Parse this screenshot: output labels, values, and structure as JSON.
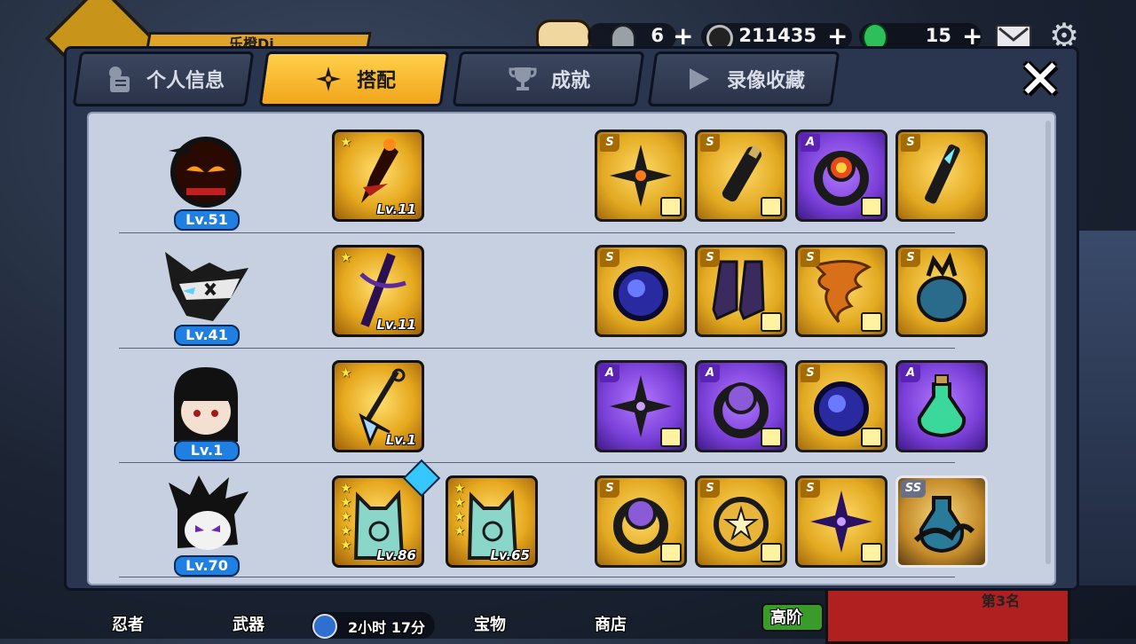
{
  "hud": {
    "player_name": "乐橙Di",
    "tickets": "6",
    "coins": "211435",
    "gems": "15"
  },
  "tabs": [
    {
      "label": "个人信息",
      "icon": "profile-icon",
      "active": false
    },
    {
      "label": "搭配",
      "icon": "shuriken-icon",
      "active": true
    },
    {
      "label": "成就",
      "icon": "trophy-icon",
      "active": false
    },
    {
      "label": "录像收藏",
      "icon": "play-icon",
      "active": false
    }
  ],
  "close_label": "✕",
  "rows": [
    {
      "ninja_level": "Lv.51",
      "weapons": [
        {
          "level": "Lv.11",
          "stars": 1
        }
      ],
      "items": [
        {
          "grade": "S",
          "name": "shuriken",
          "style": "gold",
          "tee": true
        },
        {
          "grade": "S",
          "name": "scroll",
          "style": "gold",
          "tee": true
        },
        {
          "grade": "A",
          "name": "fire-ring",
          "style": "purple",
          "tee": true
        },
        {
          "grade": "S",
          "name": "kunai-handle",
          "style": "gold",
          "tee": false
        }
      ]
    },
    {
      "ninja_level": "Lv.41",
      "weapons": [
        {
          "level": "Lv.11",
          "stars": 1
        }
      ],
      "items": [
        {
          "grade": "S",
          "name": "dark-orb",
          "style": "gold",
          "tee": false
        },
        {
          "grade": "S",
          "name": "boots",
          "style": "gold",
          "tee": true
        },
        {
          "grade": "S",
          "name": "tornado",
          "style": "gold",
          "tee": true
        },
        {
          "grade": "S",
          "name": "potion-bag",
          "style": "gold",
          "tee": false
        }
      ]
    },
    {
      "ninja_level": "Lv.1",
      "weapons": [
        {
          "level": "Lv.1",
          "stars": 1
        }
      ],
      "items": [
        {
          "grade": "A",
          "name": "shuriken",
          "style": "purple",
          "tee": true
        },
        {
          "grade": "A",
          "name": "ring",
          "style": "purple",
          "tee": true
        },
        {
          "grade": "S",
          "name": "dark-orb",
          "style": "gold",
          "tee": true
        },
        {
          "grade": "A",
          "name": "potion",
          "style": "purple",
          "tee": false
        }
      ]
    },
    {
      "ninja_level": "Lv.70",
      "weapons": [
        {
          "level": "Lv.86",
          "stars": 5
        },
        {
          "level": "Lv.65",
          "stars": 4
        }
      ],
      "items": [
        {
          "grade": "S",
          "name": "purple-ring",
          "style": "gold",
          "tee": true
        },
        {
          "grade": "S",
          "name": "star-coin",
          "style": "gold",
          "tee": true
        },
        {
          "grade": "S",
          "name": "shuriken",
          "style": "gold",
          "tee": true
        },
        {
          "grade": "SS",
          "name": "dragon-bottle",
          "style": "ss",
          "tee": false
        }
      ]
    }
  ],
  "bottom": {
    "ninja": "忍者",
    "weapon": "武器",
    "timer": "2小时 17分",
    "treasure": "宝物",
    "shop": "商店",
    "advanced": "高阶",
    "chapter": "第3名"
  },
  "colors": {
    "accent": "#f5b021",
    "panel": "#c6d0e0",
    "frame": "#2a3550"
  }
}
